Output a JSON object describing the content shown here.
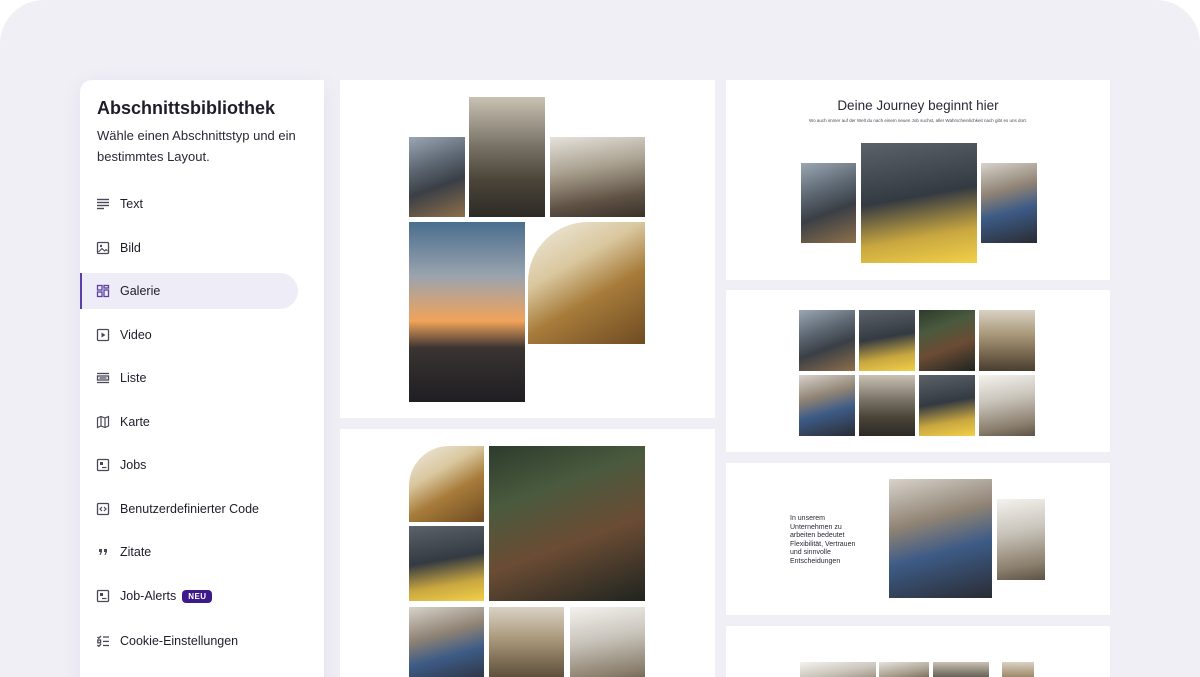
{
  "sidebar": {
    "title": "Abschnittsbibliothek",
    "description": "Wähle einen Abschnittstyp und ein bestimmtes Layout.",
    "accent_color": "#5b3ea3",
    "items": [
      {
        "label": "Text",
        "icon": "text-lines-icon",
        "active": false
      },
      {
        "label": "Bild",
        "icon": "image-icon",
        "active": false
      },
      {
        "label": "Galerie",
        "icon": "gallery-icon",
        "active": true
      },
      {
        "label": "Video",
        "icon": "video-play-icon",
        "active": false
      },
      {
        "label": "Liste",
        "icon": "list-icon",
        "active": false
      },
      {
        "label": "Karte",
        "icon": "map-icon",
        "active": false
      },
      {
        "label": "Jobs",
        "icon": "jobs-icon",
        "active": false
      },
      {
        "label": "Benutzerdefinierter Code",
        "icon": "code-icon",
        "active": false
      },
      {
        "label": "Zitate",
        "icon": "quote-icon",
        "active": false
      },
      {
        "label": "Job-Alerts",
        "icon": "job-alerts-icon",
        "active": false,
        "badge": "NEU"
      },
      {
        "label": "Cookie-Einstellungen",
        "icon": "cookie-settings-icon",
        "active": false
      }
    ]
  },
  "previews": {
    "journey": {
      "title": "Deine Journey beginnt hier",
      "subtitle": "Wo auch immer auf der Welt du nach einem neuen Job suchst, aller Wahrscheinlichkeit nach gibt es uns dort."
    },
    "text_image": {
      "text": "In unserem Unternehmen zu arbeiten bedeutet Flexibilität, Vertrauen und sinnvolle Entscheidungen"
    }
  }
}
